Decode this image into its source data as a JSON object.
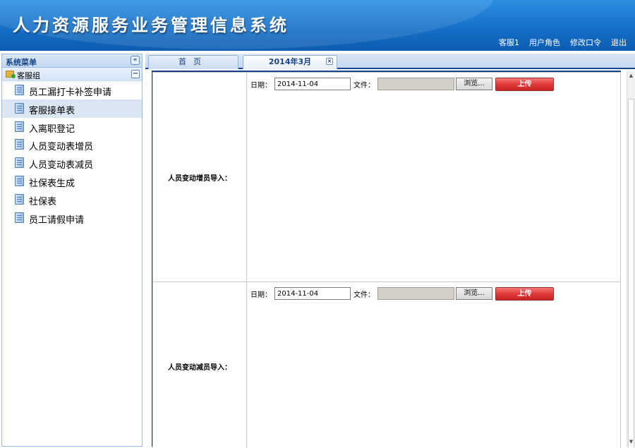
{
  "header": {
    "title": "人力资源服务业务管理信息系统",
    "links": [
      "客服1",
      "用户角色",
      "修改口令",
      "退出"
    ]
  },
  "sidebar": {
    "title": "系统菜单",
    "collapse_icon": "double-chevron-left-icon",
    "group": {
      "label": "客服组",
      "toggle": "−"
    },
    "items": [
      {
        "label": "员工漏打卡补签申请",
        "active": false
      },
      {
        "label": "客服接单表",
        "active": true
      },
      {
        "label": "入离职登记",
        "active": false
      },
      {
        "label": "人员变动表增员",
        "active": false
      },
      {
        "label": "人员变动表减员",
        "active": false
      },
      {
        "label": "社保表生成",
        "active": false
      },
      {
        "label": "社保表",
        "active": false
      },
      {
        "label": "员工请假申请",
        "active": false
      }
    ]
  },
  "tabs": [
    {
      "label": "首页",
      "active": false
    },
    {
      "label": "2014年3月",
      "active": true,
      "close": "×"
    }
  ],
  "form": {
    "date_label": "日期：",
    "file_label": "文件：",
    "browse_label": "浏览...",
    "upload_label": "上传",
    "sections": [
      {
        "label": "人员变动增员导入：",
        "date": "2014-11-04"
      },
      {
        "label": "人员变动减员导入：",
        "date": "2014-11-04"
      }
    ]
  },
  "colors": {
    "header_blue": "#1670c8",
    "border_blue": "#99bbe8",
    "upload_red": "#e03a3a"
  }
}
